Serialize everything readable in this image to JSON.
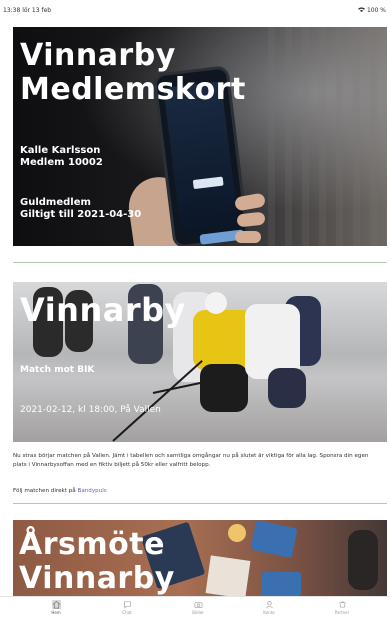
{
  "status_bar": {
    "time_date": "13:38  lör 13 feb",
    "battery": "100 %"
  },
  "card_membership": {
    "title_line1": "Vinnarby",
    "title_line2": "Medlemskort",
    "member_name": "Kalle Karlsson",
    "member_number": "Medlem 10002",
    "member_level": "Guldmedlem",
    "valid_until": "Giltigt till 2021-04-30"
  },
  "card_match": {
    "title": "Vinnarby",
    "subtitle": "Match mot BIK",
    "datetime": "2021-02-12, kl 18:00, På Vallen"
  },
  "article": {
    "body": "Nu strax börjar matchen på Vallen. Jämt i tabellen och samtliga omgångar nu på slutet är viktiga för alla lag. Sponsra din egen plats i Vinnarbysoffan med en fiktiv biljett på 50kr eller valfritt belopp.",
    "follow_prefix": "Följ matchen direkt på ",
    "follow_link": "Bandypuls"
  },
  "card_meeting": {
    "title_line1": "Årsmöte",
    "title_line2": "Vinnarby"
  },
  "tabbar": {
    "items": [
      {
        "label": "Hem",
        "icon": "home-icon",
        "active": true
      },
      {
        "label": "Chat",
        "icon": "chat-icon",
        "active": false
      },
      {
        "label": "Bilder",
        "icon": "camera-icon",
        "active": false
      },
      {
        "label": "Konto",
        "icon": "account-icon",
        "active": false
      },
      {
        "label": "Partner",
        "icon": "partner-icon",
        "active": false
      }
    ]
  }
}
